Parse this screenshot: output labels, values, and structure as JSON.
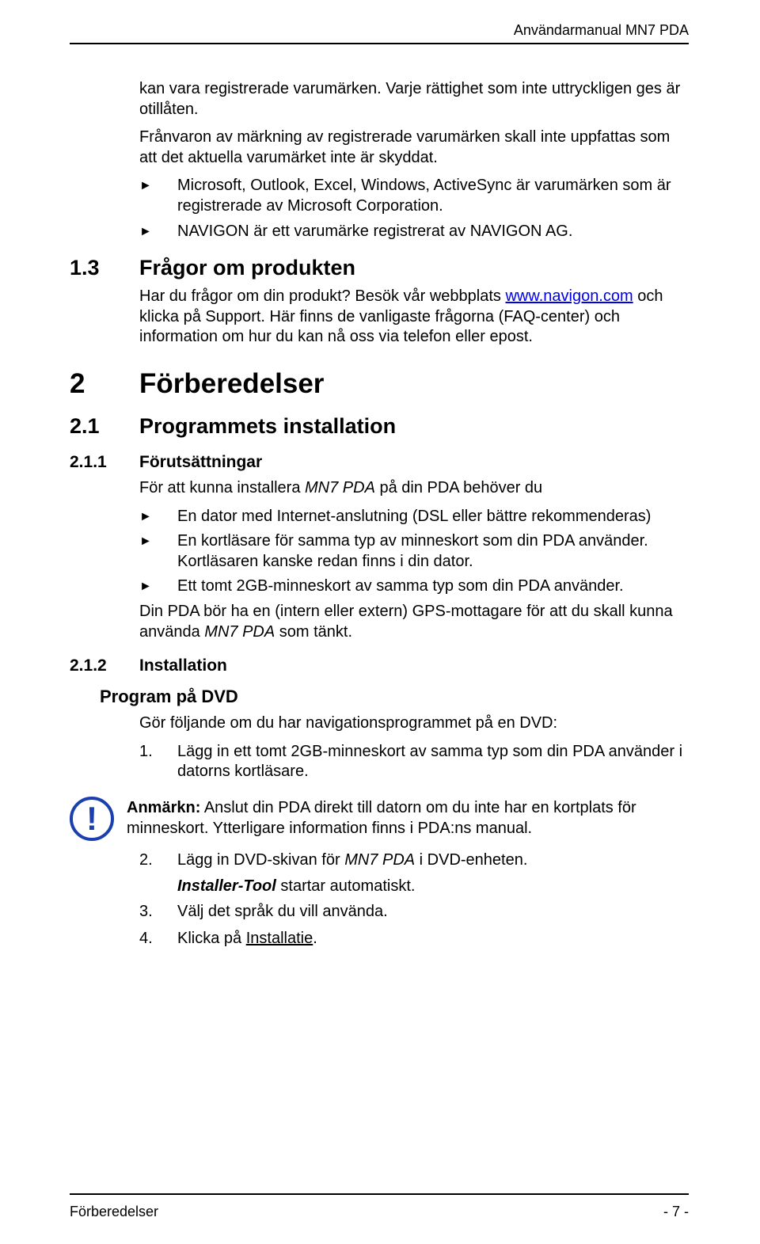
{
  "header": {
    "right": "Användarmanual MN7 PDA"
  },
  "footer": {
    "left": "Förberedelser",
    "right": "- 7 -"
  },
  "intro": {
    "p1": "kan vara registrerade varumärken. Varje rättighet som inte uttryckligen ges är otillåten.",
    "p2": "Frånvaron av märkning av registrerade varumärken skall inte uppfattas som att det aktuella varumärket inte är skyddat.",
    "bullets": [
      "Microsoft, Outlook, Excel, Windows, ActiveSync är varumärken som är registrerade av Microsoft Corporation.",
      "NAVIGON är ett varumärke registrerat av NAVIGON AG."
    ]
  },
  "s13": {
    "num": "1.3",
    "title": "Frågor om produkten",
    "text_before_link": "Har du frågor om din produkt? Besök vår webbplats ",
    "link_text": "www.navigon.com",
    "link_href": "www.navigon.com",
    "text_after_link": " och klicka på Support. Här finns de vanligaste frågorna (FAQ-center) och information om hur du kan nå oss via telefon eller epost."
  },
  "s2": {
    "num": "2",
    "title": "Förberedelser"
  },
  "s21": {
    "num": "2.1",
    "title": "Programmets installation"
  },
  "s211": {
    "num": "2.1.1",
    "title": "Förutsättningar",
    "lead_before_em": "För att kunna installera ",
    "lead_em": "MN7 PDA",
    "lead_after_em": " på din PDA behöver du",
    "bullets": [
      "En dator med Internet-anslutning (DSL eller bättre rekommenderas)",
      "En kortläsare för samma typ av minneskort som din PDA använder. Kortläsaren kanske redan finns i din dator.",
      "Ett tomt 2GB-minneskort av samma typ som din PDA använder."
    ],
    "tail_before_em": "Din PDA bör ha en (intern eller extern) GPS-mottagare för att du skall kunna använda ",
    "tail_em": "MN7 PDA",
    "tail_after_em": " som tänkt."
  },
  "s212": {
    "num": "2.1.2",
    "title": "Installation",
    "sub_heading": "Program på DVD",
    "lead": "Gör följande om du har navigationsprogrammet på en DVD:",
    "step1_num": "1.",
    "step1": "Lägg in ett tomt 2GB-minneskort av samma typ som din PDA använder i datorns kortläsare.",
    "note_bold": "Anmärkn:",
    "note_text": " Anslut din PDA direkt till datorn om du inte har en kortplats för minneskort. Ytterligare information finns i PDA:ns manual.",
    "step2_num": "2.",
    "step2_before_em": "Lägg in DVD-skivan för ",
    "step2_em": "MN7 PDA",
    "step2_after_em": " i DVD-enheten.",
    "step2_sub_em": "Installer-Tool",
    "step2_sub_after": " startar automatiskt.",
    "step3_num": "3.",
    "step3": "Välj det språk du vill använda.",
    "step4_num": "4.",
    "step4_before_u": "Klicka på ",
    "step4_u": "Installatie",
    "step4_after_u": "."
  }
}
